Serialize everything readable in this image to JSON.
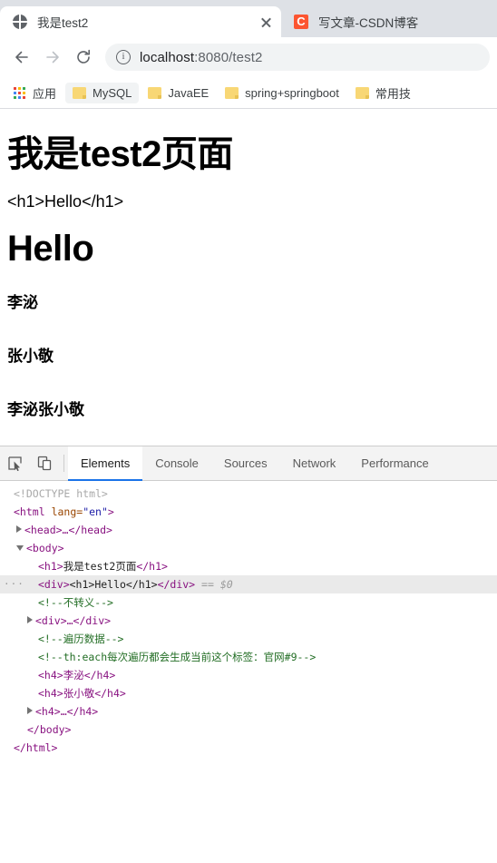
{
  "browser": {
    "tabs": [
      {
        "title": "我是test2",
        "favicon": "globe-icon",
        "active": true,
        "close_label": "×"
      },
      {
        "title": "写文章-CSDN博客",
        "favicon": "csdn-icon",
        "favicon_letter": "C",
        "active": false
      }
    ],
    "toolbar": {
      "back_label": "←",
      "forward_label": "→",
      "reload_label": "⟳",
      "site_info_label": "ⓘ",
      "url_host": "localhost",
      "url_rest": ":8080/test2",
      "url_full": "localhost:8080/test2"
    },
    "bookmarks": [
      {
        "label": "应用",
        "icon": "apps-grid-icon"
      },
      {
        "label": "MySQL",
        "icon": "folder-icon"
      },
      {
        "label": "JavaEE",
        "icon": "folder-icon"
      },
      {
        "label": "spring+springboot",
        "icon": "folder-icon"
      },
      {
        "label": "常用技",
        "icon": "folder-icon"
      }
    ],
    "apps_icon_colors": [
      "#ea4335",
      "#fbbc04",
      "#34a853",
      "#4285f4",
      "#ea4335",
      "#fbbc04",
      "#34a853",
      "#4285f4",
      "#ea4335"
    ]
  },
  "page": {
    "heading": "我是test2页面",
    "escaped_text": "<h1>Hello</h1>",
    "rendered_heading": "Hello",
    "items": [
      "李泌",
      "张小敬",
      "李泌张小敬"
    ]
  },
  "devtools": {
    "inspect_icon": "inspect-element-icon",
    "device_icon": "device-toolbar-icon",
    "tabs": [
      {
        "label": "Elements",
        "active": true
      },
      {
        "label": "Console",
        "active": false
      },
      {
        "label": "Sources",
        "active": false
      },
      {
        "label": "Network",
        "active": false
      },
      {
        "label": "Performance",
        "active": false
      }
    ],
    "accent_color": "#1a73e8",
    "dom": {
      "doctype": "<!DOCTYPE html>",
      "html_open_tag": "<html",
      "html_attr_name": "lang",
      "html_attr_value": "\"en\"",
      "html_close_bracket": ">",
      "head_collapsed": "<head>…</head>",
      "body_open": "<body>",
      "h1_line": "<h1>我是test2页面</h1>",
      "h1_tag_open": "<h1>",
      "h1_text": "我是test2页面",
      "h1_tag_close": "</h1>",
      "selected_row": {
        "dots": "···",
        "div_open": "<div>",
        "inner": "<h1>Hello</h1>",
        "div_close": "</div>",
        "selector_ref": "== $0"
      },
      "comment_1": "<!--不转义-->",
      "div_collapsed": "<div>…</div>",
      "comment_2": "<!--遍历数据-->",
      "comment_3": "<!--th:each每次遍历都会生成当前这个标签：官网#9-->",
      "h4_1": "<h4>李泌</h4>",
      "h4_2": "<h4>张小敬</h4>",
      "h4_collapsed": "<h4>…</h4>",
      "body_close": "</body>",
      "html_close": "</html>"
    }
  }
}
